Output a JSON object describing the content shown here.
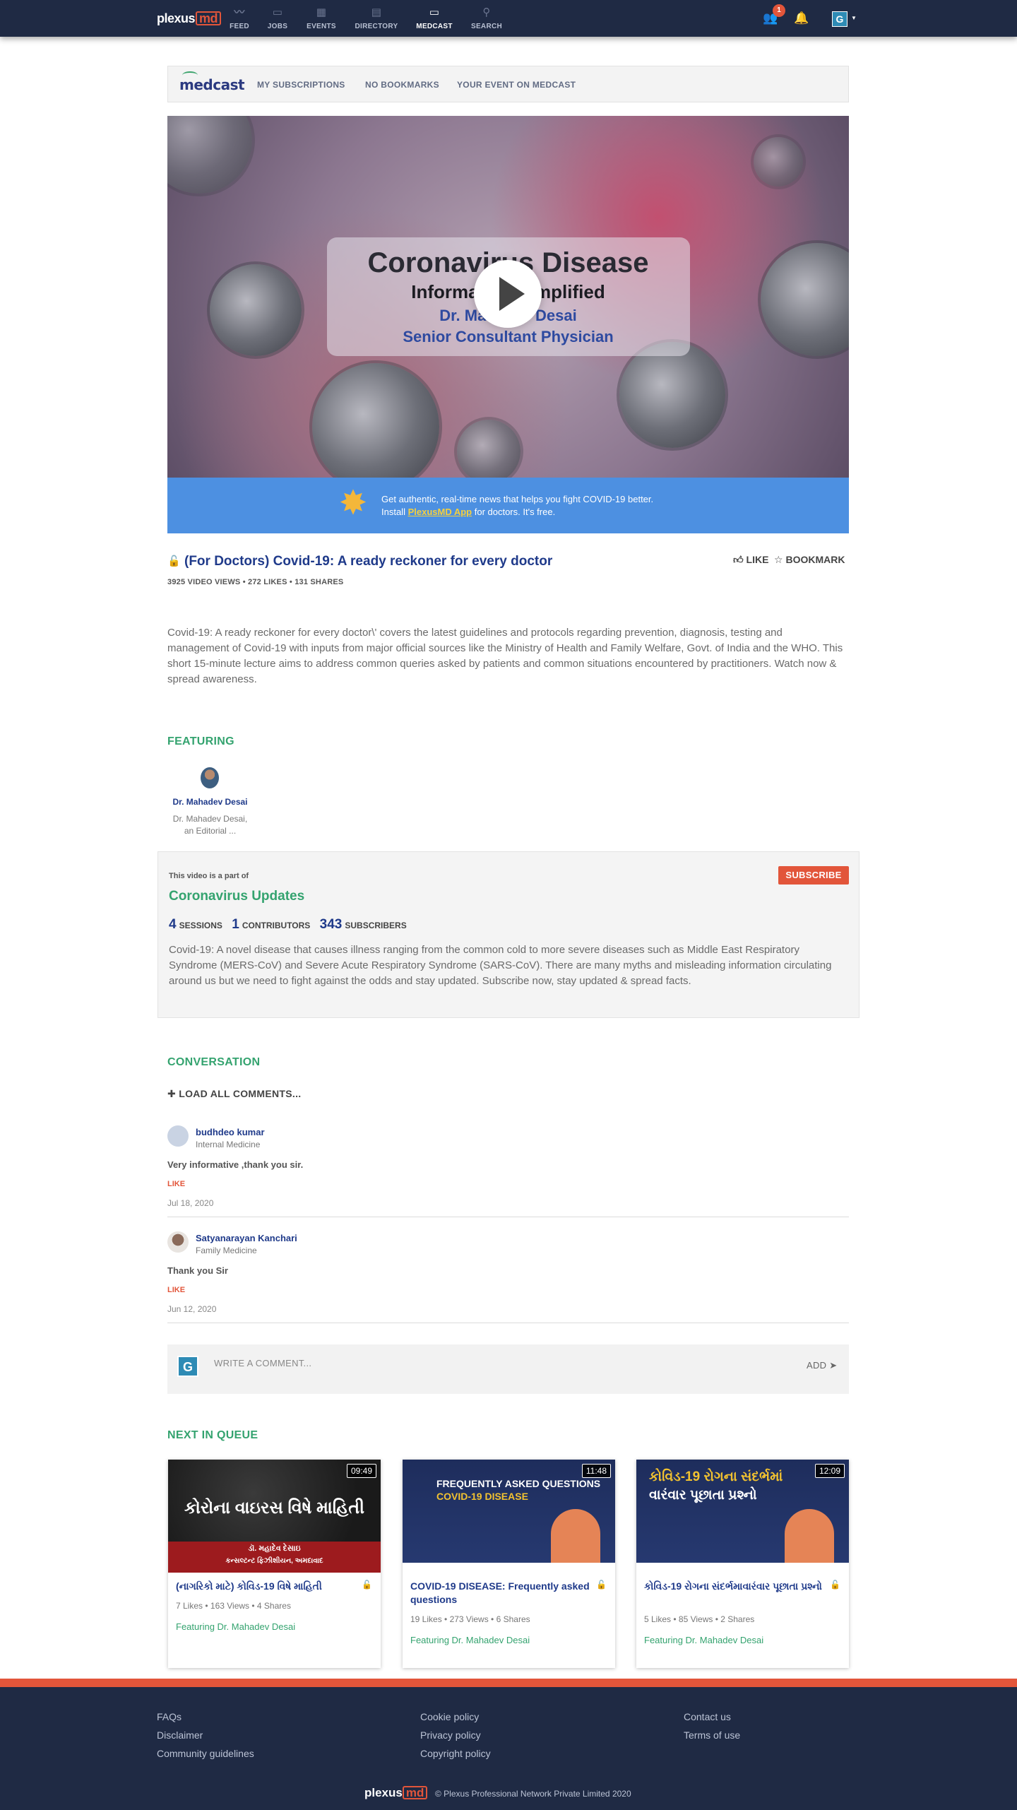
{
  "nav": {
    "logo_main": "plexus",
    "logo_md": "md",
    "items": [
      {
        "label": "FEED",
        "icon": "feed-icon"
      },
      {
        "label": "JOBS",
        "icon": "jobs-icon"
      },
      {
        "label": "EVENTS",
        "icon": "events-icon"
      },
      {
        "label": "DIRECTORY",
        "icon": "directory-icon"
      },
      {
        "label": "MEDCAST",
        "icon": "medcast-icon",
        "active": true
      },
      {
        "label": "SEARCH",
        "icon": "search-icon"
      }
    ],
    "notification_count": "1",
    "user_initial": "G"
  },
  "subnav": {
    "logo": "medcast",
    "links": [
      "MY SUBSCRIPTIONS",
      "NO BOOKMARKS",
      "YOUR EVENT ON MEDCAST"
    ]
  },
  "hero": {
    "line1": "Coronavirus Disease",
    "line2": "Information Simplified",
    "line3": "Dr. Mahadev Desai",
    "line4": "Senior Consultant Physician"
  },
  "banner": {
    "line1": "Get authentic, real-time news that helps you fight COVID-19 better.",
    "line2_pre": "Install ",
    "line2_app": "PlexusMD App",
    "line2_post": " for doctors. It's free."
  },
  "video": {
    "title": "(For Doctors) Covid-19: A ready reckoner for every doctor",
    "stats": "3925 VIDEO VIEWS • 272 LIKES • 131 SHARES",
    "like_label": "LIKE",
    "bookmark_label": "BOOKMARK",
    "description": "Covid-19: A ready reckoner for every doctor\\' covers the latest guidelines and protocols regarding prevention, diagnosis, testing and management of Covid-19 with inputs from major official sources like the Ministry of Health and Family Welfare, Govt. of India and the WHO. This short 15-minute lecture aims to address common queries asked by patients and common situations encountered by practitioners. Watch now & spread awareness."
  },
  "featuring": {
    "heading": "FEATURING",
    "name": "Dr. Mahadev Desai",
    "desc_line1": "Dr. Mahadev Desai,",
    "desc_line2": "an Editorial ..."
  },
  "series": {
    "part_of": "This video is a part of",
    "title": "Coronavirus Updates",
    "subscribe": "SUBSCRIBE",
    "sessions": "4",
    "sessions_label": "SESSIONS",
    "contributors": "1",
    "contributors_label": "CONTRIBUTORS",
    "subscribers": "343",
    "subscribers_label": "SUBSCRIBERS",
    "description": "Covid-19: A novel disease that causes illness ranging from the common cold to more severe diseases such as Middle East Respiratory Syndrome (MERS-CoV) and Severe Acute Respiratory Syndrome (SARS-CoV). There are many myths and misleading information circulating around us but we need to fight against the odds and stay updated. Subscribe now, stay updated & spread facts."
  },
  "conversation": {
    "heading": "CONVERSATION",
    "load_all": "LOAD ALL COMMENTS...",
    "comments": [
      {
        "name": "budhdeo kumar",
        "specialty": "Internal Medicine",
        "text": "Very informative ,thank you sir.",
        "like": "LIKE",
        "date": "Jul 18, 2020"
      },
      {
        "name": "Satyanarayan Kanchari",
        "specialty": "Family Medicine",
        "text": "Thank you Sir",
        "like": "LIKE",
        "date": "Jun 12, 2020"
      }
    ],
    "write_placeholder": "WRITE A COMMENT...",
    "add_label": "ADD ➤",
    "user_initial": "G"
  },
  "queue": {
    "heading": "NEXT IN QUEUE",
    "cards": [
      {
        "duration": "09:49",
        "thumb_text": "કોરોના વાઇરસ વિષે માહિતી",
        "thumb_sub1": "ડૉ. મહાદેવ દેસાઇ",
        "thumb_sub2": "કન્સલ્ટન્ટ ફિઝીશીયન, અમદાવાદ",
        "title": "(નાગરિકો માટે) કોવિડ-19 વિષે માહિતી",
        "stats": "7 Likes • 163 Views • 4 Shares",
        "featuring": "Featuring Dr. Mahadev Desai"
      },
      {
        "duration": "11:48",
        "thumb_text": "FREQUENTLY ASKED QUESTIONS",
        "thumb_sub1": "COVID-19 DISEASE",
        "thumb_sub2": "",
        "title": "COVID-19 DISEASE: Frequently asked questions",
        "stats": "19 Likes • 273 Views • 6 Shares",
        "featuring": "Featuring Dr. Mahadev Desai"
      },
      {
        "duration": "12:09",
        "thumb_text": "કોવિડ-19 રોગના સંદર્ભમાં",
        "thumb_sub1": "વારંવાર પૂછાતા પ્રશ્નો",
        "thumb_sub2": "",
        "title": "કોવિડ-19 રોગના સંદર્ભમાવારંવાર પૂછાતા પ્રશ્નો",
        "stats": "5 Likes • 85 Views • 2 Shares",
        "featuring": "Featuring Dr. Mahadev Desai"
      }
    ]
  },
  "footer": {
    "col1": [
      "FAQs",
      "Disclaimer",
      "Community guidelines"
    ],
    "col2": [
      "Cookie policy",
      "Privacy policy",
      "Copyright policy"
    ],
    "col3": [
      "Contact us",
      "Terms of use"
    ],
    "logo_main": "plexus",
    "logo_md": "md",
    "copyright": "© Plexus Professional Network Private Limited 2020"
  },
  "colors": {
    "nav_bg": "#1f2a44",
    "accent_orange": "#e2553a",
    "green": "#34a36f",
    "link_blue": "#1f3a8a",
    "banner_blue": "#4d90e1"
  }
}
